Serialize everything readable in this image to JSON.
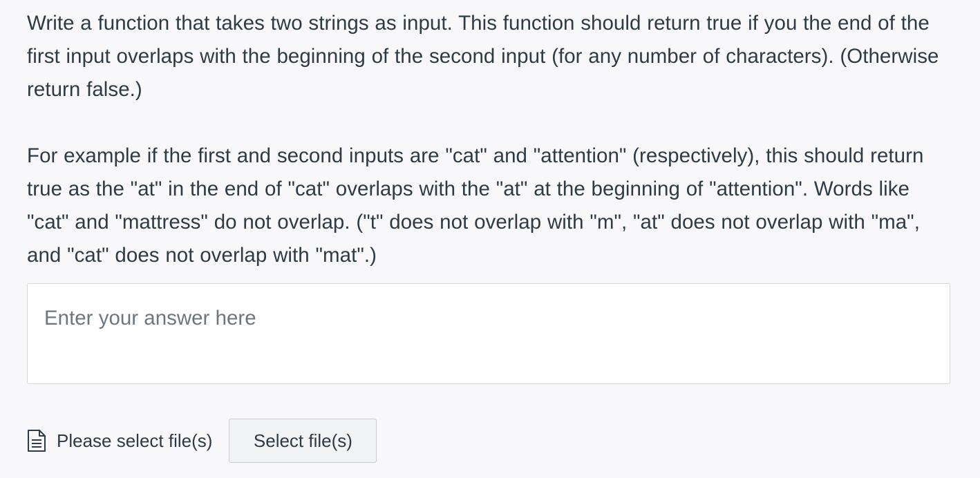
{
  "question": {
    "paragraph_1": "Write a function that takes two strings as input. This function should return true if you the end of the first input overlaps with the beginning of the second input (for any number of characters). (Otherwise return false.)",
    "paragraph_2": "For example if the first and second inputs are \"cat\" and \"attention\" (respectively), this should return true as the \"at\" in the end of \"cat\" overlaps with the \"at\" at the beginning of \"attention\". Words like \"cat\" and \"mattress\" do not overlap. (\"t\" does not overlap with \"m\", \"at\" does not overlap with \"ma\", and \"cat\" does not overlap with \"mat\".)"
  },
  "answer": {
    "placeholder": "Enter your answer here",
    "value": ""
  },
  "file_upload": {
    "icon": "document-icon",
    "label": "Please select file(s)",
    "button_label": "Select file(s)"
  }
}
